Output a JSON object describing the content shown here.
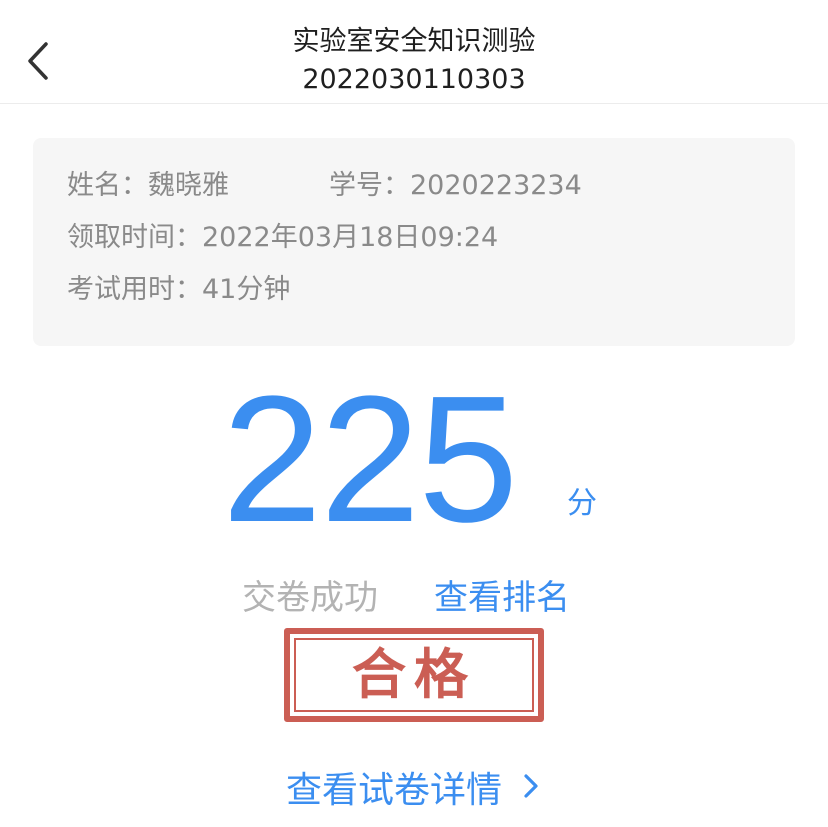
{
  "header": {
    "title": "实验室安全知识测验",
    "subtitle": "2022030110303",
    "back_icon": "chevron-left-icon"
  },
  "info": {
    "name_label": "姓名：",
    "name_value": "魏晓雅",
    "student_id_label": "学号：",
    "student_id_value": "2020223234",
    "receive_time_label": "领取时间：",
    "receive_time_value": "2022年03月18日09:24",
    "duration_label": "考试用时：",
    "duration_value": "41分钟"
  },
  "result": {
    "score": "225",
    "score_unit": "分",
    "status": "交卷成功",
    "ranking_link": "查看排名",
    "stamp_text": "合格",
    "details_link": "查看试卷详情",
    "details_icon": "chevron-right-icon"
  },
  "colors": {
    "accent": "#3b8ef0",
    "stamp": "#c4483d",
    "muted": "#8a8a8a",
    "card_bg": "#f6f6f6"
  }
}
